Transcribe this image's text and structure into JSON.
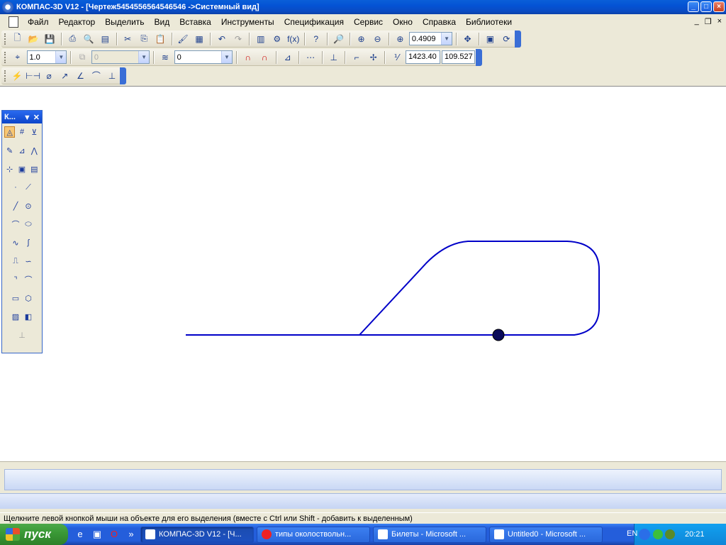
{
  "window": {
    "title": "КОМПАС-3D V12 - [Чертеж5454556564546546 ->Системный вид]",
    "controls": {
      "minimize": "_",
      "maximize": "□",
      "close": "×"
    }
  },
  "menu": {
    "items": [
      "Файл",
      "Редактор",
      "Выделить",
      "Вид",
      "Вставка",
      "Инструменты",
      "Спецификация",
      "Сервис",
      "Окно",
      "Справка",
      "Библиотеки"
    ],
    "mdi": {
      "minimize": "_",
      "restore": "❐",
      "close": "×"
    }
  },
  "toolbar1": {
    "zoom_value": "0.4909"
  },
  "toolbar2": {
    "line_scale": "1.0",
    "disabled_combo": "0",
    "layer_value": "0",
    "coord_x": "1423.40",
    "coord_y": "109.527"
  },
  "compact_panel": {
    "title": "К..."
  },
  "status": {
    "hint": "Щелкните левой кнопкой мыши на объекте для его выделения (вместе с Ctrl или Shift - добавить к выделенным)"
  },
  "taskbar": {
    "start_label": "пуск",
    "tasks": [
      {
        "label": "КОМПАС-3D V12 - [Ч...",
        "active": true
      },
      {
        "label": "типы околоствольн...",
        "active": false
      },
      {
        "label": "Билеты - Microsoft ...",
        "active": false
      },
      {
        "label": "Untitled0 - Microsoft ...",
        "active": false
      }
    ],
    "language": "EN",
    "time": "20:21"
  },
  "drawing": {
    "stroke_color": "#0000C8"
  }
}
